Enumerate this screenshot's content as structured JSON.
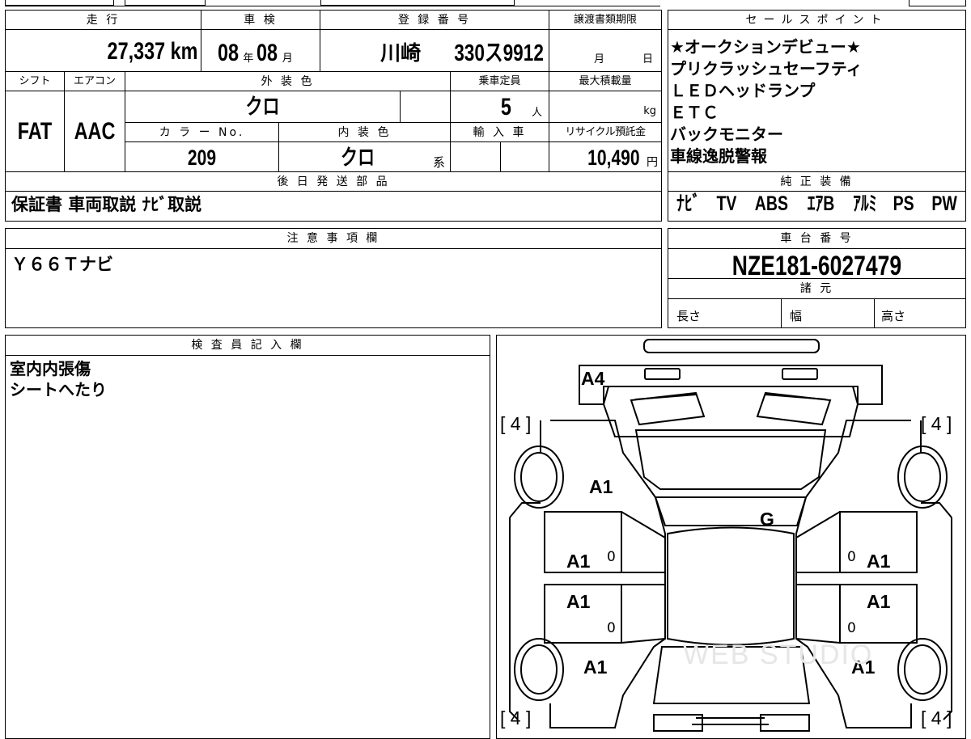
{
  "basic": {
    "mileage_header": "走 行",
    "mileage": "27,337 km",
    "shaken_header": "車 検",
    "shaken_year": "08",
    "shaken_year_unit": "年",
    "shaken_month": "08",
    "shaken_month_unit": "月",
    "registration_header": "登 録 番 号",
    "registration_region": "川崎",
    "registration_number": "330ス9912",
    "transfer_header": "譲渡書類期限",
    "transfer_month_unit": "月",
    "transfer_day_unit": "日"
  },
  "specs": {
    "shift_header": "シフト",
    "shift": "FAT",
    "aircon_header": "エアコン",
    "aircon": "AAC",
    "exterior_color_header": "外 装 色",
    "exterior_color": "クロ",
    "capacity_header": "乗車定員",
    "capacity": "5",
    "capacity_unit": "人",
    "max_load_header": "最大積載量",
    "max_load_unit": "kg",
    "color_no_header": "カ ラ ー No.",
    "color_no": "209",
    "interior_color_header": "内 装 色",
    "interior_color": "クロ",
    "interior_color_suffix": "系",
    "import_header": "輸 入 車",
    "recycle_header": "リサイクル預託金",
    "recycle_fee": "10,490",
    "recycle_unit": "円"
  },
  "later_parts": {
    "header": "後 日 発 送 部 品",
    "value": "保証書 車両取説 ﾅﾋﾞ取説"
  },
  "sales_points": {
    "header": "セールスポイント",
    "lines": [
      "★オークションデビュー★",
      "プリクラッシュセーフティ",
      "ＬＥＤヘッドランプ",
      "ＥＴＣ",
      "バックモニター",
      "車線逸脱警報"
    ]
  },
  "genuine_equipment": {
    "header": "純 正 装 備",
    "items": [
      "ﾅﾋﾞ",
      "TV",
      "ABS",
      "ｴｱB",
      "ｱﾙﾐ",
      "PS",
      "PW"
    ]
  },
  "notes": {
    "header": "注 意 事 項 欄",
    "value": "Ｙ６６Ｔナビ"
  },
  "chassis": {
    "header": "車 台 番 号",
    "number": "NZE181-6027479",
    "dimensions_header": "諸 元",
    "length_label": "長さ",
    "width_label": "幅",
    "height_label": "高さ"
  },
  "inspector": {
    "header": "検 査 員 記 入 欄",
    "lines": [
      "室内内張傷",
      "シートへたり"
    ]
  },
  "diagram": {
    "marks": {
      "rear": "A4",
      "left_rear_quarter": "A1",
      "left_rear_door": "A1",
      "left_front_door": "A1",
      "left_front_fender": "A1",
      "right_rear_door": "A1",
      "right_front_door": "A1",
      "right_front_fender": "A1",
      "rear_glass": "G"
    },
    "tires": {
      "rear_left": "[ 4 ]",
      "rear_right": "[ 4 ]",
      "front_left": "[ 4 ]",
      "front_right": "[ 4 ]"
    },
    "zeros": [
      "0",
      "0",
      "0",
      "0"
    ]
  },
  "watermark": "WEB STUDIO"
}
